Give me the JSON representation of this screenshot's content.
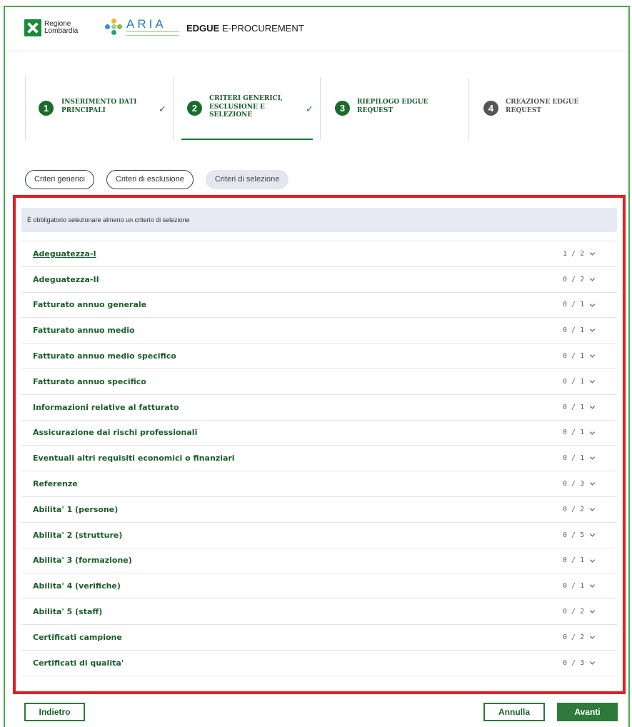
{
  "header": {
    "region_logo_line1": "Regione",
    "region_logo_line2": "Lombardia",
    "aria_logo": "ARIA",
    "app_title_bold": "EDGUE",
    "app_title_rest": " E-PROCUREMENT"
  },
  "steps": [
    {
      "number": "1",
      "line1": "INSERIMENTO DATI",
      "line2": "PRINCIPALI",
      "line3": "",
      "completed": true
    },
    {
      "number": "2",
      "line1": "CRITERI GENERICI,",
      "line2": "ESCLUSIONE E",
      "line3": "SELEZIONE",
      "completed": true
    },
    {
      "number": "3",
      "line1": "RIEPILOGO EDGUE",
      "line2": "REQUEST",
      "line3": "",
      "completed": false
    },
    {
      "number": "4",
      "line1": "CREAZIONE EDGUE",
      "line2": "REQUEST",
      "line3": "",
      "completed": false
    }
  ],
  "tabs": [
    "Criteri generici",
    "Criteri di esclusione",
    "Criteri di selezione"
  ],
  "notice": "È obbligatorio selezionare almeno un criterio di selezione",
  "criteria": [
    {
      "name": "Adeguatezza-I",
      "count": "1 / 2"
    },
    {
      "name": "Adeguatezza-II",
      "count": "0 / 2"
    },
    {
      "name": "Fatturato annuo generale",
      "count": "0 / 1"
    },
    {
      "name": "Fatturato annuo medio",
      "count": "0 / 1"
    },
    {
      "name": "Fatturato annuo medio specifico",
      "count": "0 / 1"
    },
    {
      "name": "Fatturato annuo specifico",
      "count": "0 / 1"
    },
    {
      "name": "Informazioni relative al fatturato",
      "count": "0 / 1"
    },
    {
      "name": "Assicurazione dai rischi professionali",
      "count": "0 / 1"
    },
    {
      "name": "Eventuali altri requisiti economici o finanziari",
      "count": "0 / 1"
    },
    {
      "name": "Referenze",
      "count": "0 / 3"
    },
    {
      "name": "Abilita' 1 (persone)",
      "count": "0 / 2"
    },
    {
      "name": "Abilita' 2 (strutture)",
      "count": "0 / 5"
    },
    {
      "name": "Abilita' 3 (formazione)",
      "count": "0 / 1"
    },
    {
      "name": "Abilita' 4 (verifiche)",
      "count": "0 / 1"
    },
    {
      "name": "Abilita' 5 (staff)",
      "count": "0 / 2"
    },
    {
      "name": "Certificati campione",
      "count": "0 / 2"
    },
    {
      "name": "Certificati di qualita'",
      "count": "0 / 3"
    }
  ],
  "footer": {
    "back_label": "Indietro",
    "cancel_label": "Annulla",
    "next_label": "Avanti"
  },
  "colors": {
    "brand_green": "#1a6b2c",
    "highlight_red": "#e31e24"
  }
}
